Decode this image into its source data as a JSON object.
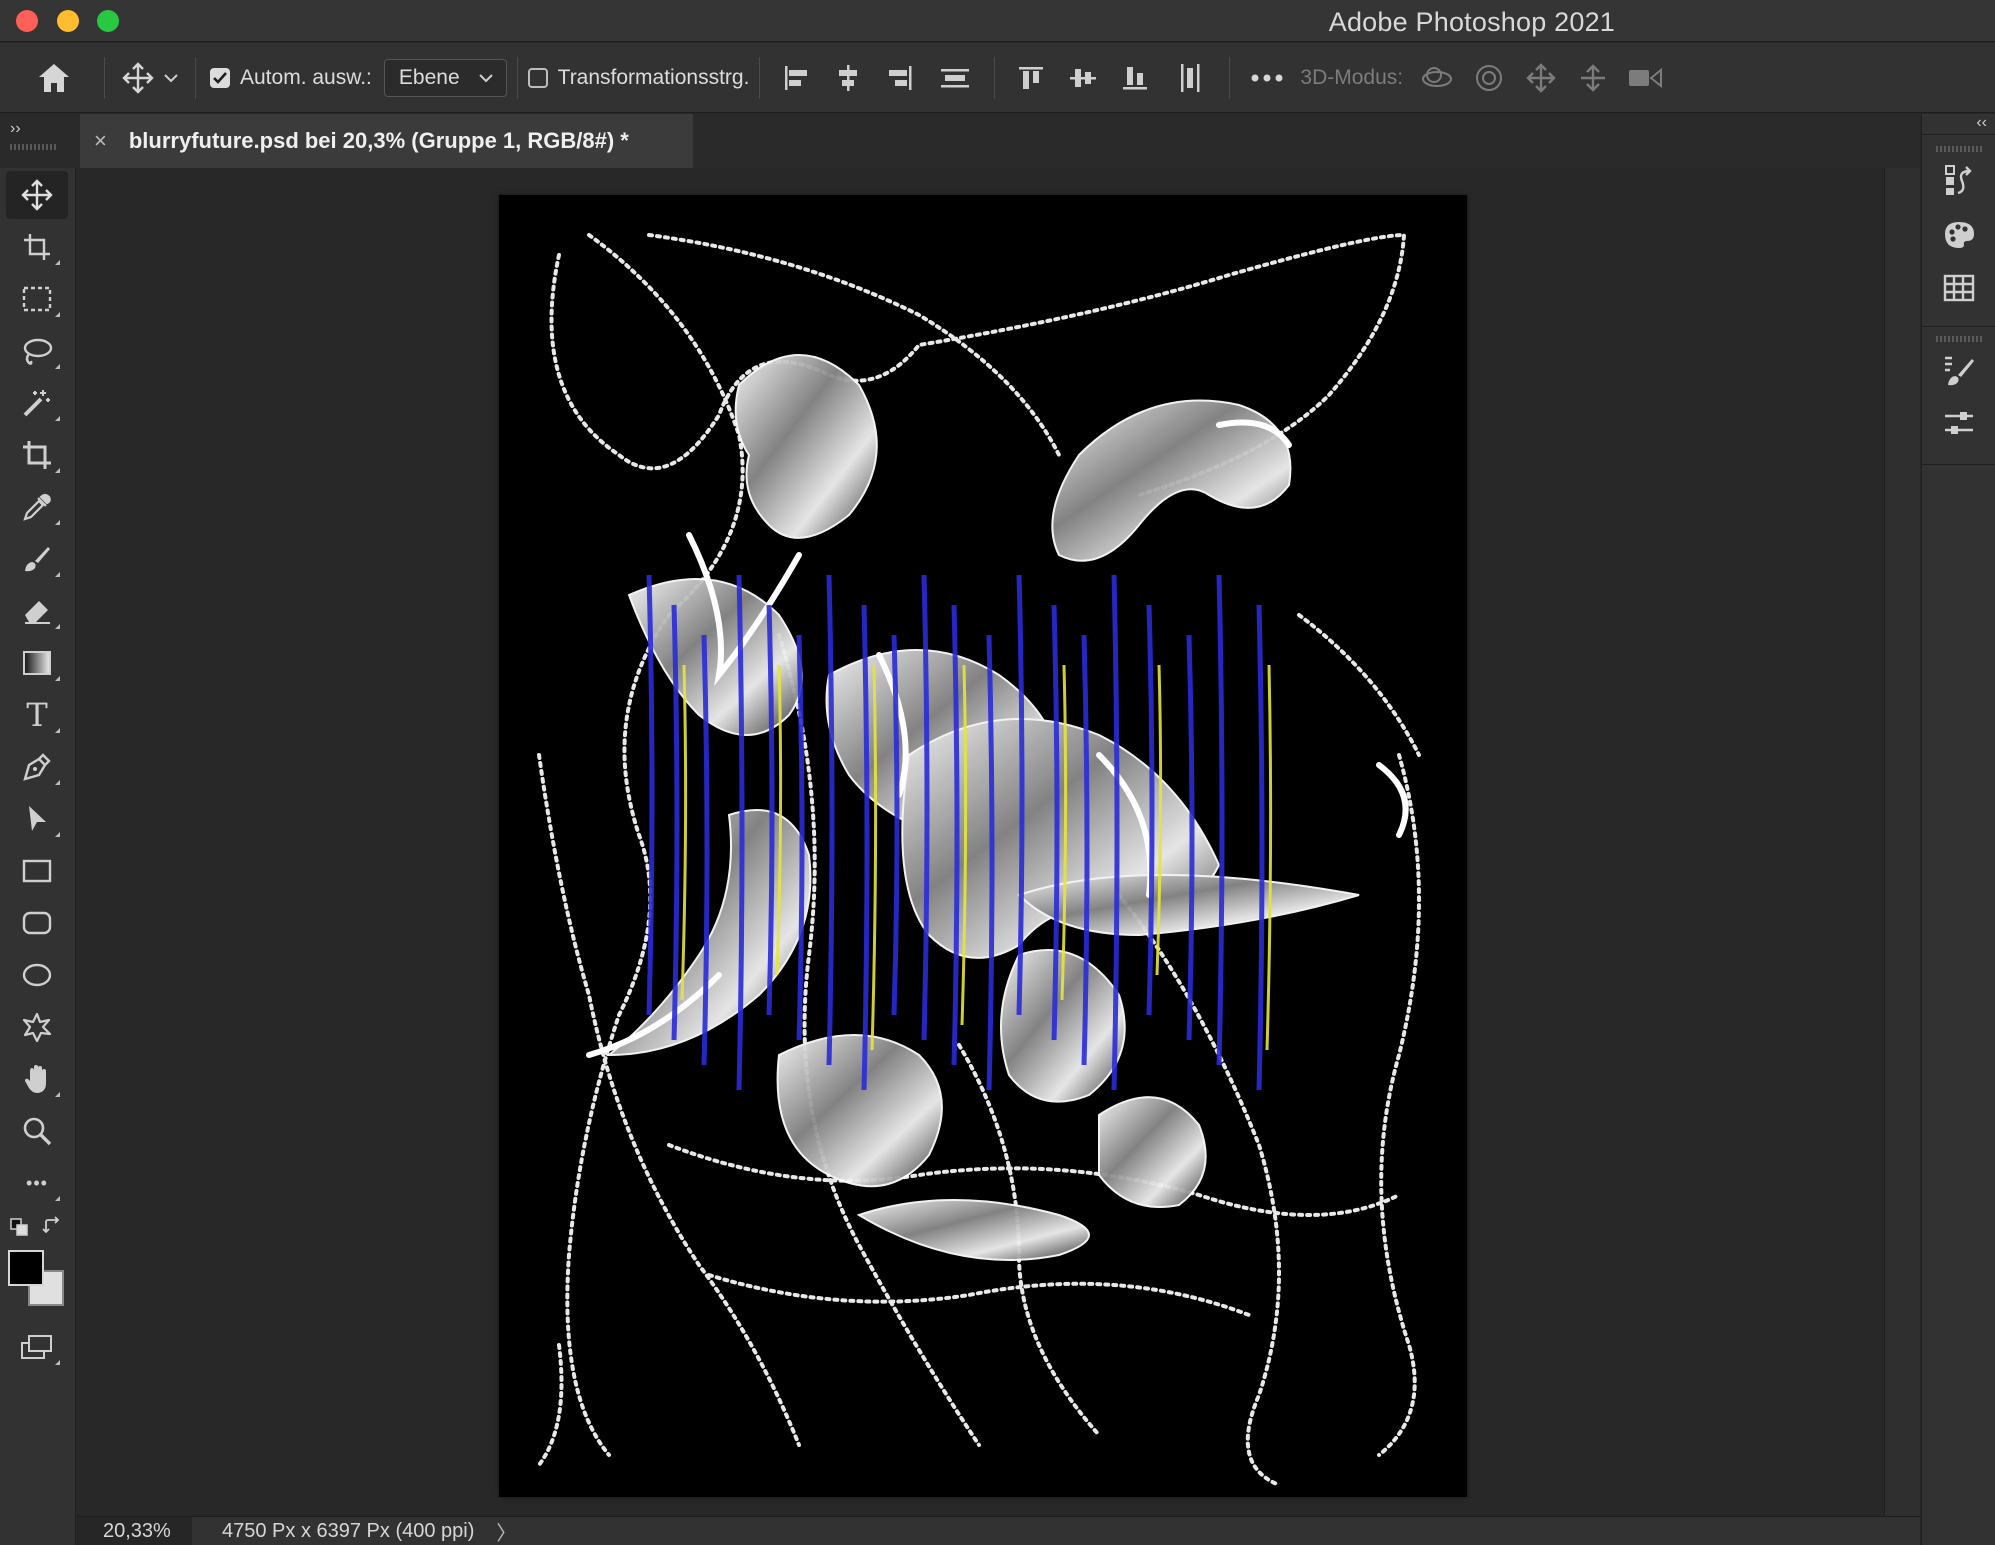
{
  "window": {
    "title": "Adobe Photoshop 2021",
    "buttons": [
      "close",
      "minimize",
      "maximize"
    ]
  },
  "options_bar": {
    "home_icon": "home-icon",
    "move_tool_icon": "move-icon",
    "auto_select_label": "Autom. ausw.:",
    "auto_select_checked": true,
    "auto_select_target": "Ebene",
    "transform_controls_label": "Transformationsstrg.",
    "transform_controls_checked": false,
    "align_icons": [
      "align-left-icon",
      "align-center-horizontal-icon",
      "align-right-icon",
      "distribute-horizontal-icon",
      "align-top-icon",
      "align-center-vertical-icon",
      "align-bottom-icon",
      "distribute-vertical-icon"
    ],
    "more_icon": "more-icon",
    "three_d_mode_label": "3D-Modus:",
    "three_d_icons": [
      "orbit-3d-icon",
      "roll-3d-icon",
      "pan-3d-icon",
      "slide-3d-icon",
      "zoom-camera-3d-icon"
    ]
  },
  "document_tab": {
    "close_symbol": "×",
    "name": "blurryfuture.psd bei 20,3% (Gruppe 1, RGB/8#) *",
    "collapse_left": "››"
  },
  "tools": [
    "move-icon",
    "artboard-icon",
    "rectangular-marquee-icon",
    "lasso-icon",
    "magic-wand-icon",
    "crop-icon",
    "eyedropper-icon",
    "brush-icon",
    "eraser-icon",
    "gradient-icon",
    "type-icon",
    "pen-icon",
    "path-selection-icon",
    "rectangle-icon",
    "rounded-rectangle-icon",
    "ellipse-icon",
    "custom-shape-icon",
    "hand-icon",
    "zoom-icon",
    "more-tools-icon"
  ],
  "type_tool_glyph": "T",
  "more_tools_glyph": "•••",
  "colors": {
    "foreground": "#000000",
    "background": "#e0e0e0",
    "accent_blue": "#2b2bd6",
    "accent_yellow": "#e6e63a"
  },
  "status_bar": {
    "zoom": "20,33%",
    "doc_info": "4750 Px x 6397 Px (400 ppi)",
    "arrow": "〉"
  },
  "right_dock": {
    "collapse": "‹‹",
    "panel_icons": [
      "history-icon",
      "color-swatches-icon",
      "table-grid-icon",
      "brush-settings-icon",
      "properties-icon"
    ]
  }
}
